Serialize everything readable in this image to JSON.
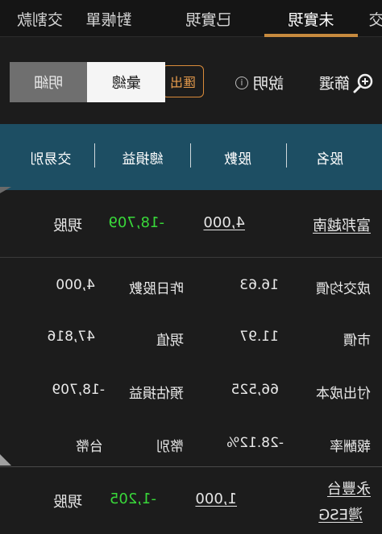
{
  "tabs": [
    {
      "label": "未實現",
      "active": true
    },
    {
      "label": "已實現",
      "active": false
    },
    {
      "label": "對帳單",
      "active": false
    },
    {
      "label": "交割款",
      "active": false
    },
    {
      "label": "交",
      "active": false
    }
  ],
  "toolbar": {
    "filter_label": "篩選",
    "help_label": "說明",
    "help_icon_glyph": "i",
    "export_label": "匯出",
    "segment": [
      {
        "label": "彙總",
        "selected": true
      },
      {
        "label": "明細",
        "selected": false
      }
    ]
  },
  "table": {
    "headers": [
      "股名",
      "股數",
      "總損益",
      "交易別"
    ],
    "rows": [
      {
        "name": "富邦越南",
        "shares": "4,000",
        "pnl": "-18,709",
        "trade_type": "現股"
      },
      {
        "name": "永豐台灣ESG",
        "name_line1": "永豐台",
        "name_line2": "灣ESG",
        "shares": "1,000",
        "pnl": "-1,205",
        "trade_type": "現股"
      }
    ],
    "detail": {
      "avg_cost_label": "成交均價",
      "avg_cost": "16.63",
      "prev_shares_label": "昨日股數",
      "prev_shares": "4,000",
      "price_label": "市價",
      "price": "11.97",
      "value_label": "現值",
      "value": "47,816",
      "cost_label": "付出成本",
      "cost": "66,525",
      "est_pnl_label": "預估損益",
      "est_pnl": "-18,709",
      "roi_label": "報酬率",
      "roi": "-28.12%",
      "currency_label": "幣別",
      "currency": "台幣"
    }
  },
  "colors": {
    "header_bg": "#1d4e63",
    "accent": "#c78a3e",
    "loss": "#39d83a",
    "export": "#e49a4c"
  }
}
